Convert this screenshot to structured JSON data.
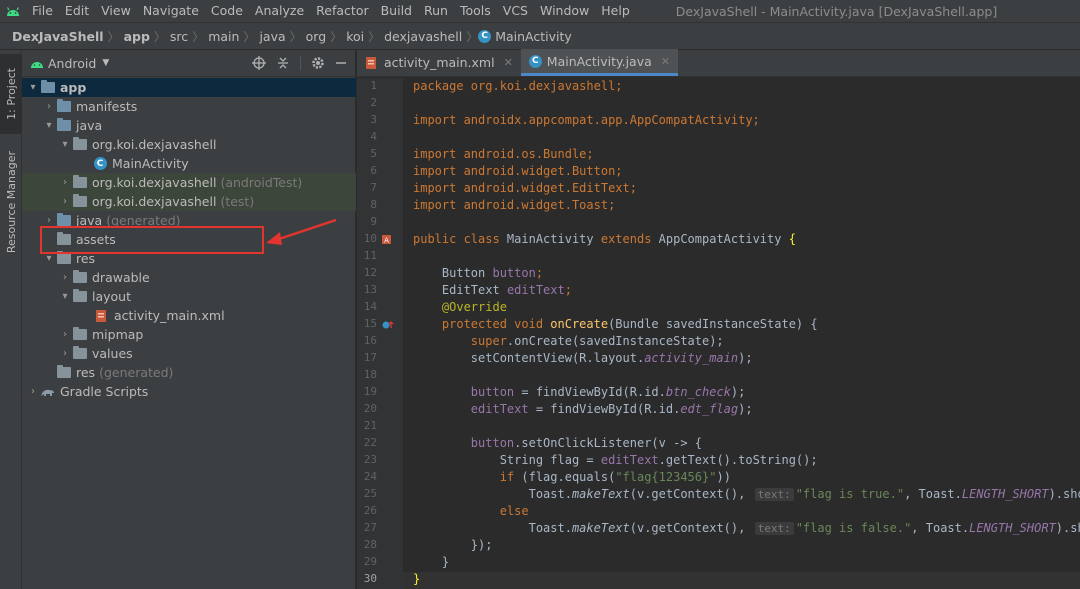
{
  "menubar": {
    "items": [
      "File",
      "Edit",
      "View",
      "Navigate",
      "Code",
      "Analyze",
      "Refactor",
      "Build",
      "Run",
      "Tools",
      "VCS",
      "Window",
      "Help"
    ],
    "window_title": "DexJavaShell - MainActivity.java [DexJavaShell.app]"
  },
  "breadcrumbs": [
    "DexJavaShell",
    "app",
    "src",
    "main",
    "java",
    "org",
    "koi",
    "dexjavashell",
    "MainActivity"
  ],
  "left_strip": {
    "project_tab": "1: Project",
    "resource_tab": "Resource Manager"
  },
  "project_panel": {
    "view_label": "Android",
    "tree": [
      {
        "label": "app",
        "suffix": ""
      },
      {
        "label": "manifests",
        "suffix": ""
      },
      {
        "label": "java",
        "suffix": ""
      },
      {
        "label": "org.koi.dexjavashell",
        "suffix": ""
      },
      {
        "label": "MainActivity",
        "suffix": ""
      },
      {
        "label": "org.koi.dexjavashell",
        "suffix": "(androidTest)"
      },
      {
        "label": "org.koi.dexjavashell",
        "suffix": "(test)"
      },
      {
        "label": "java",
        "suffix": "(generated)"
      },
      {
        "label": "assets",
        "suffix": ""
      },
      {
        "label": "res",
        "suffix": ""
      },
      {
        "label": "drawable",
        "suffix": ""
      },
      {
        "label": "layout",
        "suffix": ""
      },
      {
        "label": "activity_main.xml",
        "suffix": ""
      },
      {
        "label": "mipmap",
        "suffix": ""
      },
      {
        "label": "values",
        "suffix": ""
      },
      {
        "label": "res",
        "suffix": "(generated)"
      },
      {
        "label": "Gradle Scripts",
        "suffix": ""
      }
    ]
  },
  "editor": {
    "tabs": [
      {
        "label": "activity_main.xml"
      },
      {
        "label": "MainActivity.java"
      }
    ],
    "line_numbers": [
      "1",
      "2",
      "3",
      "4",
      "5",
      "6",
      "7",
      "8",
      "9",
      "10",
      "11",
      "12",
      "13",
      "14",
      "15",
      "16",
      "17",
      "18",
      "19",
      "20",
      "21",
      "22",
      "23",
      "24",
      "25",
      "26",
      "27",
      "28",
      "29",
      "30"
    ],
    "code": {
      "l1": "package org.koi.dexjavashell;",
      "l3": "import androidx.appcompat.app.AppCompatActivity;",
      "l5": "import android.os.Bundle;",
      "l6": "import android.widget.Button;",
      "l7": "import android.widget.EditText;",
      "l8": "import android.widget.Toast;",
      "l10_kw": "public class",
      "l10_name": " MainActivity ",
      "l10_ext": "extends",
      "l10_super": " AppCompatActivity ",
      "l10_brace": "{",
      "l12_type": "Button ",
      "l12_var": "button",
      "l12_end": ";",
      "l13_type": "EditText ",
      "l13_var": "editText",
      "l13_end": ";",
      "l14": "@Override",
      "l15_kw": "protected void ",
      "l15_fn": "onCreate",
      "l15_rest": "(Bundle savedInstanceState) {",
      "l16_kw": "super",
      "l16_rest": ".onCreate(savedInstanceState);",
      "l17_a": "setContentView(R.layout.",
      "l17_b": "activity_main",
      "l17_c": ");",
      "l19_var": "button",
      "l19_a": " = findViewById(R.id.",
      "l19_b": "btn_check",
      "l19_c": ");",
      "l20_var": "editText",
      "l20_a": " = findViewById(R.id.",
      "l20_b": "edt_flag",
      "l20_c": ");",
      "l22_var": "button",
      "l22_rest": ".setOnClickListener(v -> {",
      "l23_a": "String flag = ",
      "l23_var": "editText",
      "l23_b": ".getText().toString();",
      "l24_kw": "if",
      "l24_a": " (flag.equals(",
      "l24_str": "\"flag{123456}\"",
      "l24_b": "))",
      "l25_a": "Toast.",
      "l25_m": "makeText",
      "l25_b": "(v.getContext(), ",
      "l25_hint": "text:",
      "l25_str": "\"flag is true.\"",
      "l25_c": ", Toast.",
      "l25_f": "LENGTH_SHORT",
      "l25_d": ").show();",
      "l26_kw": "else",
      "l27_a": "Toast.",
      "l27_m": "makeText",
      "l27_b": "(v.getContext(), ",
      "l27_hint": "text:",
      "l27_str": "\"flag is false.\"",
      "l27_c": ", Toast.",
      "l27_f": "LENGTH_SHORT",
      "l27_d": ").show();",
      "l28": "});",
      "l29": "}",
      "l30": "}"
    }
  },
  "colors": {
    "background": "#2b2b2b",
    "panel": "#3c3f41",
    "keyword": "#cc7832",
    "string": "#6a8759",
    "field": "#9876aa",
    "annotation_box": "#e3342f"
  }
}
